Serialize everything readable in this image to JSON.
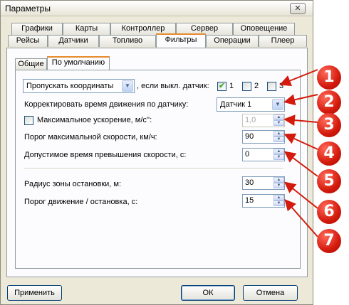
{
  "window": {
    "title": "Параметры",
    "close_glyph": "✕"
  },
  "tabs_row1": [
    {
      "label": "Графики"
    },
    {
      "label": "Карты"
    },
    {
      "label": "Контроллер"
    },
    {
      "label": "Сервер"
    },
    {
      "label": "Оповещение"
    }
  ],
  "tabs_row2": [
    {
      "label": "Рейсы"
    },
    {
      "label": "Датчики"
    },
    {
      "label": "Топливо"
    },
    {
      "label": "Фильтры"
    },
    {
      "label": "Операции"
    },
    {
      "label": "Плеер"
    }
  ],
  "active_tab": "Фильтры",
  "subtabs": [
    {
      "label": "Общие"
    },
    {
      "label": "По умолчанию"
    }
  ],
  "filters": {
    "skip_combo_value": "Пропускать координаты",
    "skip_suffix": ", если выкл. датчик:",
    "sensor_checks": [
      {
        "label": "1",
        "checked": true
      },
      {
        "label": "2",
        "checked": false
      },
      {
        "label": "3",
        "checked": false
      }
    ],
    "adjust_label": "Корректировать время движения по датчику:",
    "adjust_combo_value": "Датчик 1",
    "max_accel_label": "Максимальное ускорение, м/с'':",
    "max_accel_checked": false,
    "max_accel_value": "1,0",
    "max_speed_label": "Порог максимальной скорости, км/ч:",
    "max_speed_value": "90",
    "overspeed_time_label": "Допустимое время превышения скорости, с:",
    "overspeed_time_value": "0",
    "stop_radius_label": "Радиус зоны остановки, м:",
    "stop_radius_value": "30",
    "move_stop_label": "Порог движение / остановка, с:",
    "move_stop_value": "15"
  },
  "buttons": {
    "apply": "Применить",
    "ok": "ОК",
    "cancel": "Отмена"
  },
  "callouts": [
    "1",
    "2",
    "3",
    "4",
    "5",
    "6",
    "7"
  ],
  "colors": {
    "callout": "#d31a0c",
    "tab_highlight": "#e68b2c"
  }
}
